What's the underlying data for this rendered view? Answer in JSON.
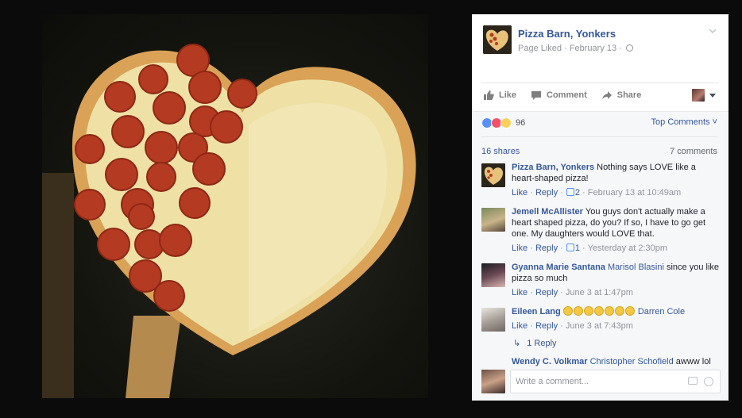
{
  "post": {
    "page_name": "Pizza Barn, Yonkers",
    "page_meta": "Page Liked · February 13 ·"
  },
  "actions": {
    "like": "Like",
    "comment": "Comment",
    "share": "Share"
  },
  "reactions": {
    "count": "96",
    "sort_label": "Top Comments"
  },
  "stats": {
    "shares": "16 shares",
    "comments": "7 comments"
  },
  "comments": [
    {
      "author": "Pizza Barn, Yonkers",
      "text": "Nothing says LOVE like a heart-shaped pizza!",
      "like": "Like",
      "reply": "Reply",
      "likes": "2",
      "time": "February 13 at 10:49am"
    },
    {
      "author": "Jemell McAllister",
      "text": "You guys don't actually make a heart shaped pizza, do you? If so, I have to go get one. My daughters would LOVE that.",
      "like": "Like",
      "reply": "Reply",
      "likes": "1",
      "time": "Yesterday at 2:30pm"
    },
    {
      "author": "Gyanna Marie Santana",
      "tag": "Marisol Blasini",
      "text": "since you like pizza so much",
      "like": "Like",
      "reply": "Reply",
      "time": "June 3 at 1:47pm"
    },
    {
      "author": "Eileen Lang",
      "tag": "Darren Cole",
      "like": "Like",
      "reply": "Reply",
      "time": "June 3 at 7:43pm",
      "replies": "1 Reply"
    },
    {
      "author": "Wendy C. Volkmar",
      "tag": "Christopher Schofield",
      "text": "awww lol"
    }
  ],
  "composer": {
    "placeholder": "Write a comment..."
  },
  "colors": {
    "link": "#365899",
    "meta": "#90949c"
  }
}
